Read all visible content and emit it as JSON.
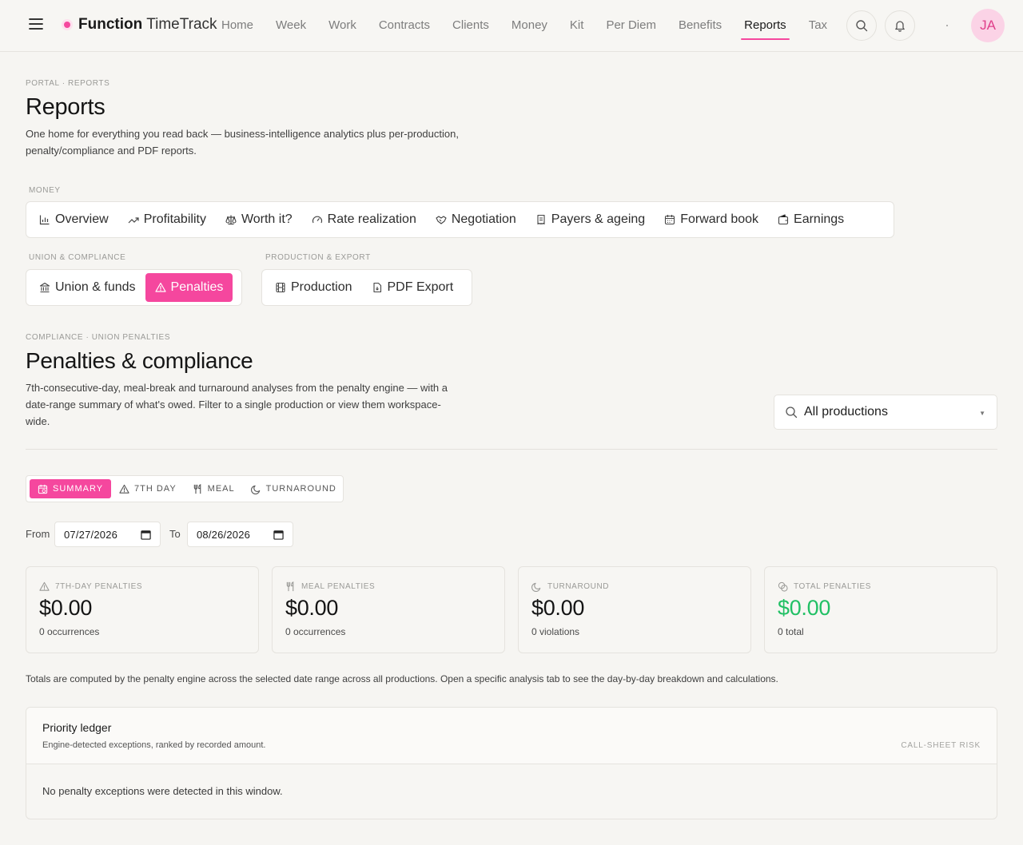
{
  "brand": {
    "name_bold": "Function",
    "name_light": "TimeTrack"
  },
  "nav": [
    "Home",
    "Week",
    "Work",
    "Contracts",
    "Clients",
    "Money",
    "Kit",
    "Per Diem",
    "Benefits",
    "Reports",
    "Tax"
  ],
  "nav_active": "Reports",
  "user": {
    "initials": "JA"
  },
  "header": {
    "breadcrumb": "PORTAL · REPORTS",
    "title": "Reports",
    "description_line1": "One home for everything you read back — business-intelligence analytics plus per-production,",
    "description_line2": "penalty/compliance and PDF reports."
  },
  "groups": {
    "money": {
      "label": "MONEY",
      "items": [
        {
          "label": "Overview",
          "icon": "bar-chart-icon"
        },
        {
          "label": "Profitability",
          "icon": "trending-up-icon"
        },
        {
          "label": "Worth it?",
          "icon": "scale-icon"
        },
        {
          "label": "Rate realization",
          "icon": "gauge-icon"
        },
        {
          "label": "Negotiation",
          "icon": "handshake-icon"
        },
        {
          "label": "Payers & ageing",
          "icon": "receipt-icon"
        },
        {
          "label": "Forward book",
          "icon": "calendar-icon"
        },
        {
          "label": "Earnings",
          "icon": "wallet-icon"
        }
      ]
    },
    "union": {
      "label": "UNION & COMPLIANCE",
      "items": [
        {
          "label": "Union & funds",
          "icon": "bank-icon"
        },
        {
          "label": "Penalties",
          "icon": "alert-triangle-icon"
        }
      ]
    },
    "production": {
      "label": "PRODUCTION & EXPORT",
      "items": [
        {
          "label": "Production",
          "icon": "film-icon"
        },
        {
          "label": "PDF Export",
          "icon": "file-download-icon"
        }
      ]
    }
  },
  "section": {
    "breadcrumb": "COMPLIANCE · UNION PENALTIES",
    "title": "Penalties & compliance",
    "description_line1": "7th-consecutive-day, meal-break and turnaround analyses from the penalty engine — with a",
    "description_line2": "date-range summary of what's owed. Filter to a single production or view them workspace-",
    "description_line3": "wide."
  },
  "production_filter": {
    "value": "All productions"
  },
  "tabs": [
    "SUMMARY",
    "7TH DAY",
    "MEAL",
    "TURNAROUND"
  ],
  "tab_active": "SUMMARY",
  "dates": {
    "from_label": "From",
    "from_value": "07/27/2026",
    "to_label": "To",
    "to_value": "08/26/2026"
  },
  "cards": [
    {
      "label": "7TH-DAY PENALTIES",
      "value": "$0.00",
      "sub": "0 occurrences",
      "icon": "alert-triangle-icon"
    },
    {
      "label": "MEAL PENALTIES",
      "value": "$0.00",
      "sub": "0 occurrences",
      "icon": "utensils-icon"
    },
    {
      "label": "TURNAROUND",
      "value": "$0.00",
      "sub": "0 violations",
      "icon": "moon-icon"
    },
    {
      "label": "TOTAL PENALTIES",
      "value": "$0.00",
      "sub": "0 total",
      "icon": "coins-icon"
    }
  ],
  "accent_color": "#f5479e",
  "total_color": "#22c065",
  "note": "Totals are computed by the penalty engine across the selected date range across all productions. Open a specific analysis tab to see the day-by-day breakdown and calculations.",
  "ledger": {
    "title": "Priority ledger",
    "subtitle": "Engine-detected exceptions, ranked by recorded amount.",
    "tag": "CALL-SHEET RISK",
    "empty": "No penalty exceptions were detected in this window."
  }
}
